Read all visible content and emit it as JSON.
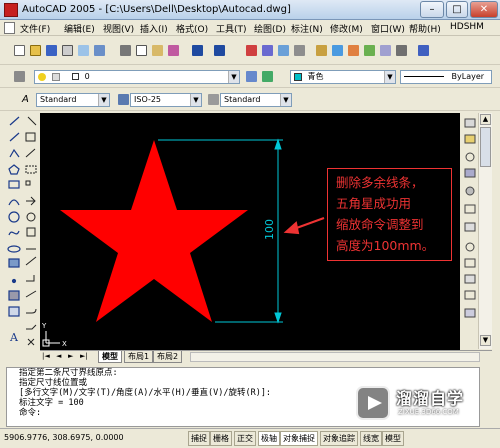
{
  "window": {
    "title": "AutoCAD 2005 - [C:\\Users\\Dell\\Desktop\\Autocad.dwg]",
    "controls": {
      "minimize": "–",
      "maximize": "□",
      "close": "✕"
    }
  },
  "menu": {
    "items": [
      "文件(F)",
      "编辑(E)",
      "视图(V)",
      "插入(I)",
      "格式(O)",
      "工具(T)",
      "绘图(D)",
      "标注(N)",
      "修改(M)",
      "窗口(W)",
      "帮助(H)",
      "HDSHM"
    ]
  },
  "toolbar_layers": {
    "layer_value": "0",
    "color_value": "青色",
    "linetype_value": "ByLayer"
  },
  "toolbar_styles": {
    "text_style": "Standard",
    "dim_style": "ISO-25",
    "table_style": "Standard"
  },
  "drawing": {
    "dimension_text": "100",
    "ucs_x_label": "X",
    "ucs_y_label": "Y",
    "star_color": "#ff0000",
    "dimension_color": "#00c8d8"
  },
  "annotation": {
    "lines": [
      "删除多余线条，",
      "五角星成功用",
      "缩放命令调整到",
      "高度为100mm。"
    ],
    "color": "#ee3333"
  },
  "layout_tabs": [
    "模型",
    "布局1",
    "布局2"
  ],
  "command_window": {
    "lines": [
      "指定第二条尺寸界线原点:",
      "指定尺寸线位置或",
      "[多行文字(M)/文字(T)/角度(A)/水平(H)/垂直(V)/旋转(R)]:",
      "标注文字 = 100",
      "命令:"
    ]
  },
  "status_bar": {
    "coordinates": "5906.9776, 308.6975, 0.0000",
    "toggles": [
      "捕捉",
      "栅格",
      "正交",
      "极轴",
      "对象捕捉",
      "对象追踪",
      "线宽",
      "模型"
    ]
  },
  "watermark": {
    "name": "溜溜自学",
    "url": "ZIXUE.3D66.COM"
  }
}
